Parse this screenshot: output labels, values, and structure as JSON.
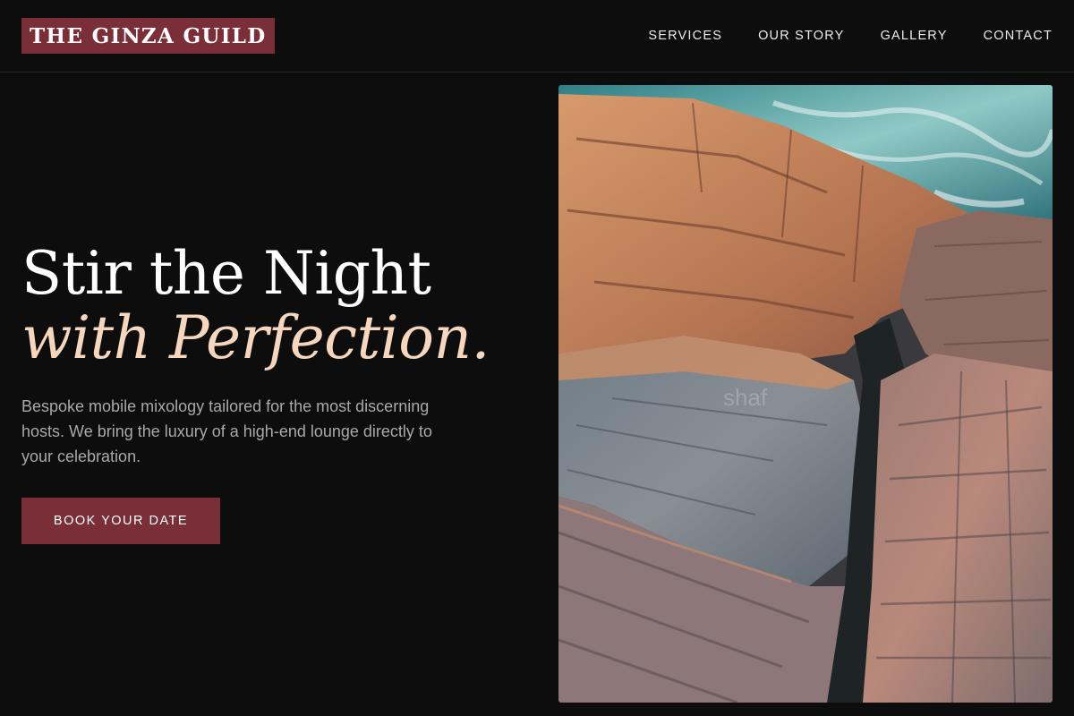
{
  "brand": {
    "logo_text": "THE GINZA GUILD",
    "accent_color": "#7a2e38",
    "highlight_color": "#f6d6bd"
  },
  "nav": {
    "items": [
      {
        "label": "SERVICES"
      },
      {
        "label": "OUR STORY"
      },
      {
        "label": "GALLERY"
      },
      {
        "label": "CONTACT"
      }
    ]
  },
  "hero": {
    "title_line1": "Stir the Night",
    "title_line2": "with Perfection.",
    "subtitle": "Bespoke mobile mixology tailored for the most discerning hosts. We bring the luxury of a high-end lounge directly to your celebration.",
    "cta_label": "BOOK YOUR DATE"
  },
  "image": {
    "description_icon": "coastal-rocks-photo",
    "watermark": "shaf"
  }
}
